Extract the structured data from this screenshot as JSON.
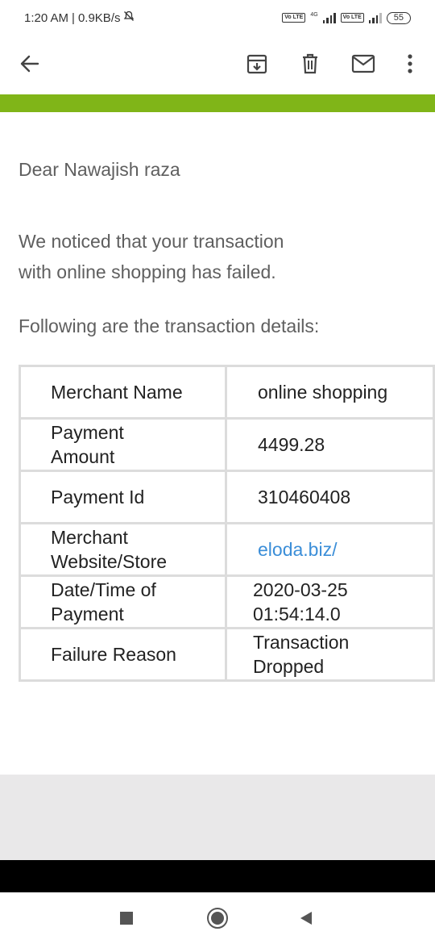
{
  "status_bar": {
    "time": "1:20 AM",
    "separator": "|",
    "net_speed": "0.9KB/s",
    "network_type": "4G",
    "volte_label": "Vo LTE",
    "battery": "55"
  },
  "app_bar": {
    "icons": [
      "back-arrow-icon",
      "archive-icon",
      "delete-icon",
      "mail-icon",
      "more-vert-icon"
    ]
  },
  "email": {
    "greeting": "Dear Nawajish raza",
    "notice": "We noticed that your transaction\nwith online shopping has failed.",
    "details_intro": "Following are the transaction details:",
    "details": [
      {
        "label": "Merchant Name",
        "value": "online shopping"
      },
      {
        "label": "Payment\nAmount",
        "value": "4499.28"
      },
      {
        "label": "Payment Id",
        "value": "310460408"
      },
      {
        "label": "Merchant\nWebsite/Store",
        "value": "eloda.biz/"
      },
      {
        "label": "Date/Time of\nPayment",
        "value": "2020-03-25\n01:54:14.0"
      },
      {
        "label": "Failure Reason",
        "value": "Transaction\nDropped"
      }
    ]
  },
  "colors": {
    "accent_green": "#80b518",
    "link_blue": "#3b8ed8",
    "text_grey": "#5f5f5f"
  },
  "nav_bar": {
    "icons": [
      "recents-square-icon",
      "home-circle-icon",
      "back-triangle-icon"
    ]
  }
}
